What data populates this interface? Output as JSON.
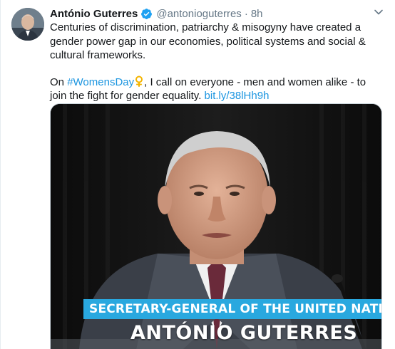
{
  "author": {
    "name": "António Guterres",
    "handle": "@antonioguterres",
    "separator": "·",
    "time": "8h",
    "verified": true,
    "avatar_icon": "profile-photo"
  },
  "tweet": {
    "paragraph1": "Centuries of discrimination, patriarchy & misogyny have created a gender power gap in our economies, political systems and social & cultural frameworks.",
    "p2_before": "On ",
    "hashtag": "#WomensDay",
    "emoji_icon": "female-sign-icon",
    "p2_after": ", I call on everyone - men and women alike - to join the fight for gender equality. ",
    "link": "bit.ly/38lHh9h"
  },
  "media": {
    "caption_title": "SECRETARY-GENERAL OF THE UNITED NATIONS",
    "caption_name": "ANTÓNIO GUTERRES",
    "caption_color": "#29a8df"
  },
  "colors": {
    "link": "#1b95e0",
    "verified": "#1da1f2",
    "secondary_text": "#657786"
  }
}
